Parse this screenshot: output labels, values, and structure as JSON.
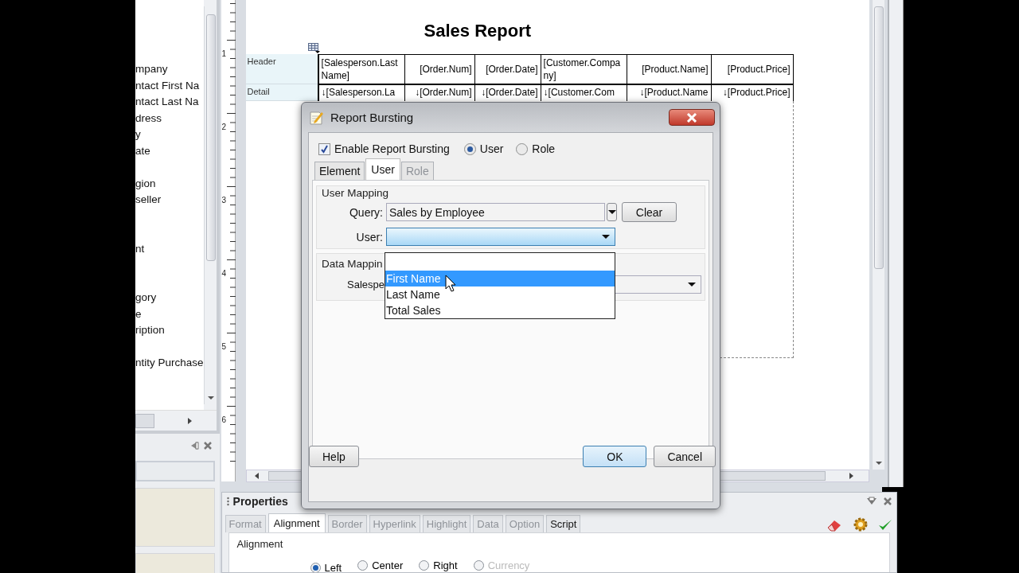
{
  "field_list": {
    "items": [
      "mpany",
      "ntact First Na",
      "ntact Last Na",
      "dress",
      "y",
      "ate",
      "gion",
      "seller",
      "nt",
      "gory",
      "e",
      "ription",
      "ntity Purchase"
    ]
  },
  "ruler": {
    "marks": [
      "1",
      "2",
      "3",
      "4",
      "5",
      "6"
    ]
  },
  "report": {
    "title": "Sales Report",
    "bands": [
      {
        "label": "Header",
        "cells": [
          "[Salesperson.Last Name]",
          "[Order.Num]",
          "[Order.Date]",
          "[Customer.Company]",
          "[Product.Name]",
          "[Product.Price]"
        ]
      },
      {
        "label": "Detail",
        "cells": [
          "↓[Salesperson.La",
          "↓[Order.Num]",
          "↓[Order.Date]",
          "↓[Customer.Com",
          "↓[Product.Name",
          "↓[Product.Price]"
        ]
      }
    ]
  },
  "dialog": {
    "title": "Report Bursting",
    "enable": {
      "label": "Enable Report Bursting",
      "checked": true
    },
    "modes": [
      {
        "label": "User",
        "selected": true
      },
      {
        "label": "Role",
        "selected": false
      }
    ],
    "tabs": [
      {
        "label": "Element",
        "selected": false,
        "disabled": false
      },
      {
        "label": "User",
        "selected": true,
        "disabled": false
      },
      {
        "label": "Role",
        "selected": false,
        "disabled": true
      }
    ],
    "user_mapping": {
      "title": "User Mapping",
      "query_label": "Query:",
      "query_value": "Sales by Employee",
      "clear_button": "Clear",
      "user_label": "User:"
    },
    "data_mapping": {
      "title": "Data Mappin",
      "field_label": "Salespe"
    },
    "dropdown": {
      "options": [
        {
          "label": "First Name",
          "selected": true
        },
        {
          "label": "Last Name",
          "selected": false
        },
        {
          "label": "Total Sales",
          "selected": false
        }
      ]
    },
    "buttons": [
      {
        "label": "Help",
        "default": false,
        "kind": "left"
      },
      {
        "label": "OK",
        "default": true,
        "kind": "right"
      },
      {
        "label": "Cancel",
        "default": false,
        "kind": "right"
      }
    ]
  },
  "properties": {
    "title": "Properties",
    "tabs": [
      {
        "label": "Format",
        "selected": false,
        "disabled": true
      },
      {
        "label": "Alignment",
        "selected": true,
        "disabled": false
      },
      {
        "label": "Border",
        "selected": false,
        "disabled": true
      },
      {
        "label": "Hyperlink",
        "selected": false,
        "disabled": true
      },
      {
        "label": "Highlight",
        "selected": false,
        "disabled": true
      },
      {
        "label": "Data",
        "selected": false,
        "disabled": true
      },
      {
        "label": "Option",
        "selected": false,
        "disabled": true
      },
      {
        "label": "Script",
        "selected": false,
        "disabled": false
      }
    ],
    "group": "Alignment",
    "alignment_options": [
      {
        "label": "Left",
        "selected": true,
        "disabled": false
      },
      {
        "label": "Center",
        "selected": false,
        "disabled": false
      },
      {
        "label": "Right",
        "selected": false,
        "disabled": false
      },
      {
        "label": "Currency",
        "selected": false,
        "disabled": true
      }
    ]
  }
}
